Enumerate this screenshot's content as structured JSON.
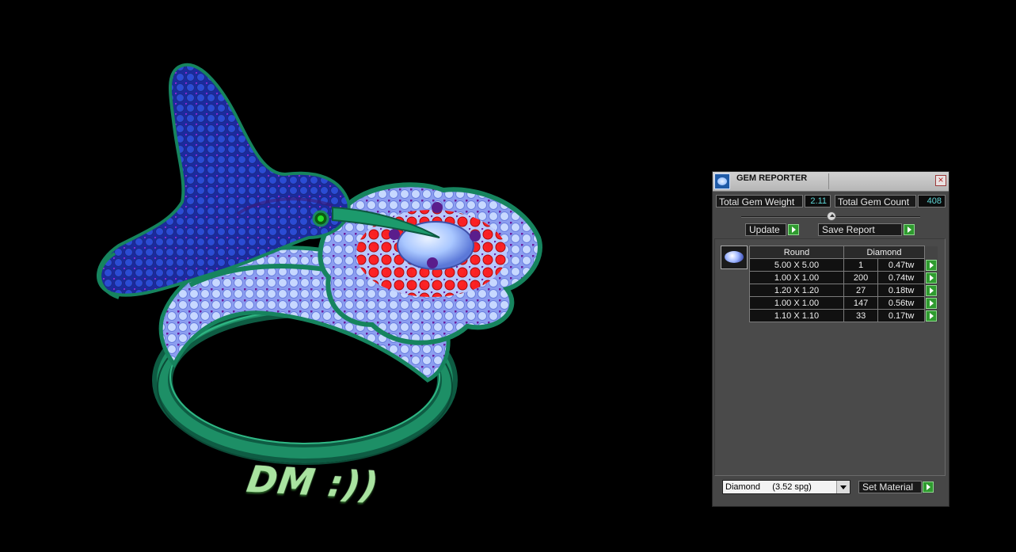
{
  "scene": {
    "watermark": "DM :))"
  },
  "panel": {
    "title": "GEM REPORTER",
    "total_weight_label": "Total Gem Weight",
    "total_weight_value": "2.11",
    "total_count_label": "Total Gem Count",
    "total_count_value": "408",
    "update_label": "Update",
    "save_report_label": "Save Report",
    "table": {
      "shape_header": "Round",
      "material_header": "Diamond",
      "rows": [
        {
          "size": "5.00 X 5.00",
          "count": "1",
          "weight": "0.47tw"
        },
        {
          "size": "1.00 X 1.00",
          "count": "200",
          "weight": "0.74tw"
        },
        {
          "size": "1.20 X 1.20",
          "count": "27",
          "weight": "0.18tw"
        },
        {
          "size": "1.00 X 1.00",
          "count": "147",
          "weight": "0.56tw"
        },
        {
          "size": "1.10 X 1.10",
          "count": "33",
          "weight": "0.17tw"
        }
      ]
    },
    "material_select": "Diamond     (3.52 spg)",
    "set_material_label": "Set Material"
  }
}
